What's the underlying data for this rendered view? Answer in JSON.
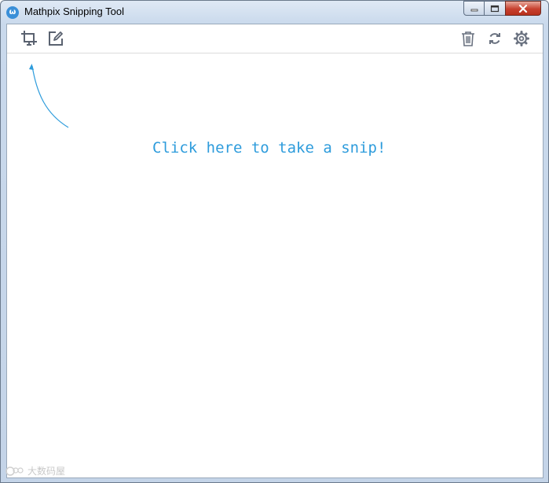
{
  "window": {
    "title": "Mathpix Snipping Tool",
    "app_icon_glyph": "ω"
  },
  "toolbar": {
    "left_buttons": [
      {
        "icon": "screen-crop-icon"
      },
      {
        "icon": "edit-icon"
      }
    ],
    "right_buttons": [
      {
        "icon": "trash-icon"
      },
      {
        "icon": "sync-icon"
      },
      {
        "icon": "gear-icon"
      }
    ]
  },
  "main": {
    "hint_text": "Click here to take a snip!"
  },
  "watermark": {
    "text": "大数码屋"
  },
  "colors": {
    "accent": "#2e9cdc",
    "toolbar_icon": "#5a6270",
    "close_button": "#c7412f"
  }
}
